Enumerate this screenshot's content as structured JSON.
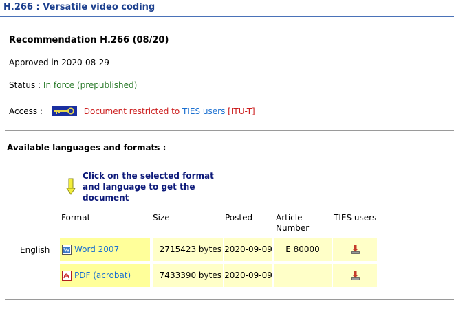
{
  "page": {
    "title": "H.266 : Versatile video coding"
  },
  "recommendation": {
    "title": "Recommendation H.266 (08/20)",
    "approved": "Approved in 2020-08-29",
    "status_label": "Status : ",
    "status_value": "In force (prepublished)",
    "access_label": "Access : ",
    "access_restricted": "Document restricted to ",
    "access_link": "TIES users",
    "access_suffix": " [ITU-T]"
  },
  "languages": {
    "heading": "Available languages and formats :",
    "hint": "Click on the selected format and language to get the document",
    "headers": {
      "format": "Format",
      "size": "Size",
      "posted": "Posted",
      "article": "Article Number",
      "ties": "TIES users"
    },
    "language": "English",
    "rows": [
      {
        "format": "Word 2007",
        "icon": "word-icon",
        "size": "2715423 bytes",
        "posted": "2020-09-09",
        "article": "E 80000"
      },
      {
        "format": "PDF (acrobat)",
        "icon": "pdf-icon",
        "size": "7433390 bytes",
        "posted": "2020-09-09",
        "article": ""
      }
    ]
  },
  "colors": {
    "title": "#1b3f8e",
    "status": "#2a7a2a",
    "restricted": "#cc1e1e",
    "link": "#1a6fd0",
    "row_highlight": "#ffff9a",
    "row_bg": "#ffffc8"
  }
}
